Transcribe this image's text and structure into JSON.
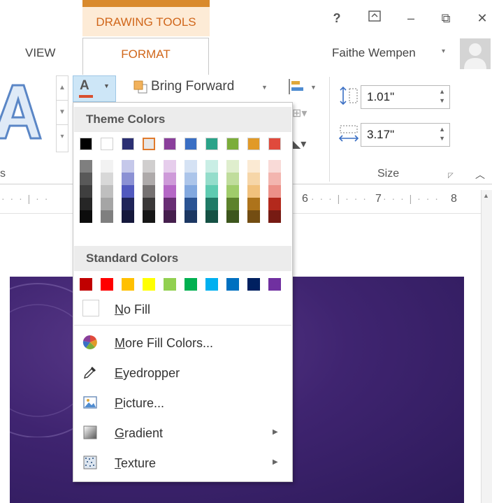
{
  "window": {
    "context_tab_group": "DRAWING TOOLS",
    "help_icon": "?",
    "restore_icon": "ribbon-display-icon",
    "minimize_icon": "–",
    "maximize_icon": "⧉",
    "close_icon": "✕"
  },
  "tabs": {
    "view": "VIEW",
    "format": "FORMAT"
  },
  "user": {
    "name": "Faithe Wempen",
    "caret": "▾"
  },
  "ribbon": {
    "text_fill_letter": "A",
    "bring_forward": "Bring Forward",
    "height_value": "1.01\"",
    "width_value": "3.17\"",
    "size_group_label": "Size",
    "left_group_label_fragment": "s"
  },
  "ruler": {
    "numbers": [
      "6",
      "7",
      "8"
    ]
  },
  "fill_menu": {
    "theme_colors_label": "Theme Colors",
    "standard_colors_label": "Standard Colors",
    "no_fill": "No Fill",
    "more_fill_colors": "More Fill Colors...",
    "eyedropper": "Eyedropper",
    "picture": "Picture...",
    "gradient": "Gradient",
    "texture": "Texture",
    "theme_top": [
      "#000000",
      "#ffffff",
      "#2b2f72",
      "#e7e6e6",
      "#8a3f9b",
      "#3a6fc4",
      "#2aa389",
      "#7bad3a",
      "#e19a28",
      "#e04a3c"
    ],
    "theme_shades": [
      [
        "#7f7f7f",
        "#595959",
        "#3f3f3f",
        "#262626",
        "#0c0c0c"
      ],
      [
        "#f2f2f2",
        "#d8d8d8",
        "#bfbfbf",
        "#a5a5a5",
        "#7f7f7f"
      ],
      [
        "#c5c8ea",
        "#8b91d4",
        "#5159be",
        "#1f2459",
        "#15183b"
      ],
      [
        "#d0cece",
        "#aeaaaa",
        "#757171",
        "#3a3838",
        "#161616"
      ],
      [
        "#e6cdec",
        "#ce9ad9",
        "#b567c6",
        "#682e74",
        "#451f4d"
      ],
      [
        "#d5e2f4",
        "#acc5ea",
        "#82a8df",
        "#2a5393",
        "#1c3762"
      ],
      [
        "#c9eee5",
        "#94ddcb",
        "#5ecbb1",
        "#1f7a66",
        "#155144"
      ],
      [
        "#dfeecd",
        "#c0dd9c",
        "#a0cc6a",
        "#5c822b",
        "#3d561d"
      ],
      [
        "#fbead3",
        "#f6d6a8",
        "#f1c17c",
        "#ad731b",
        "#734d12"
      ],
      [
        "#f9dad7",
        "#f3b5af",
        "#ec9088",
        "#b3291c",
        "#771b13"
      ]
    ],
    "standard": [
      "#c00000",
      "#ff0000",
      "#ffc000",
      "#ffff00",
      "#92d050",
      "#00b050",
      "#00b0f0",
      "#0070c0",
      "#002060",
      "#7030a0"
    ]
  }
}
